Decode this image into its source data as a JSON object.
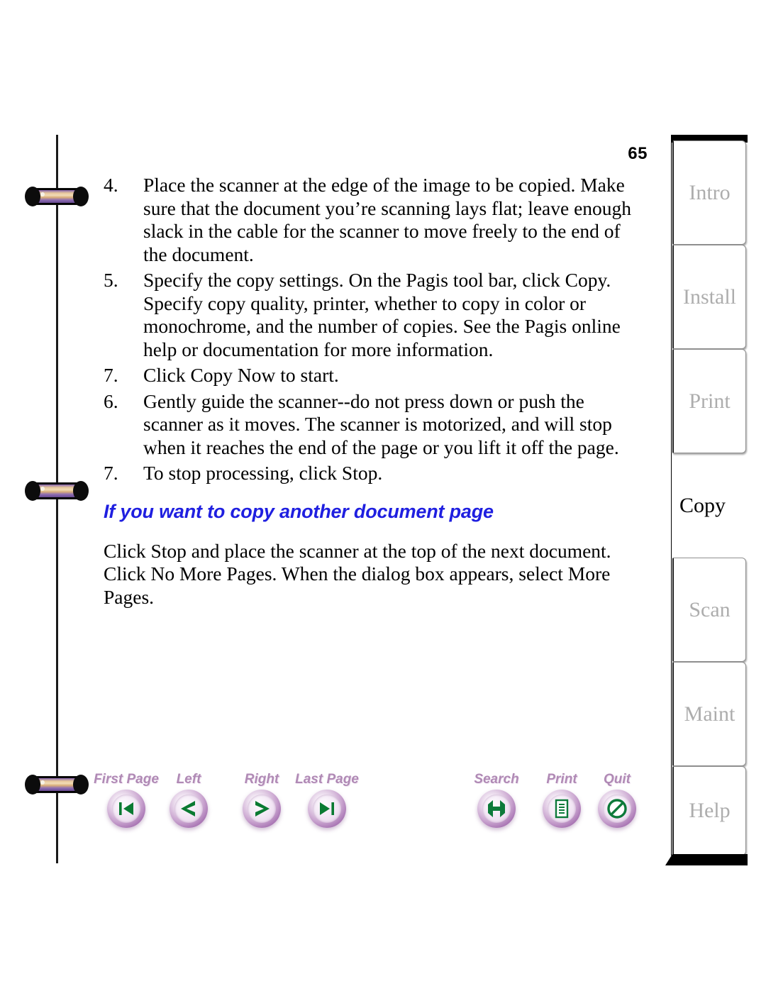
{
  "page": {
    "number": "65"
  },
  "content": {
    "steps": [
      {
        "num": "4.",
        "text": "Place the scanner at the edge of the image to be copied. Make sure that the document you’re scanning lays flat; leave enough slack in the cable for the scanner to move freely to the end of the document."
      },
      {
        "num": "5.",
        "text": "Specify the copy settings. On the Pagis tool bar, click Copy. Specify copy quality, printer, whether to copy in color or monochrome, and the number of copies. See the Pagis online help or documentation for more information."
      },
      {
        "num": "7.",
        "text": "Click Copy Now to start."
      },
      {
        "num": "6.",
        "text": "Gently guide the scanner--do not press down or push the scanner as it moves. The scanner is motorized, and will stop when it reaches the end of the page or you lift it off the page."
      },
      {
        "num": "7.",
        "text": "To stop processing, click Stop."
      }
    ],
    "heading": "If you want to copy another document page",
    "heading_color": "#1f1fe0",
    "paragraph": "Click Stop and place the scanner at the top of the next document. Click No More Pages. When the dialog box appears, select More Pages."
  },
  "navbar": {
    "left_group": [
      {
        "label": "First Page",
        "icon": "first-page-icon"
      },
      {
        "label": "Left",
        "icon": "left-arrow-icon"
      },
      {
        "label": "Right",
        "icon": "right-arrow-icon"
      },
      {
        "label": "Last Page",
        "icon": "last-page-icon"
      }
    ],
    "right_group": [
      {
        "label": "Search",
        "icon": "search-icon"
      },
      {
        "label": "Print",
        "icon": "print-icon"
      },
      {
        "label": "Quit",
        "icon": "quit-icon"
      }
    ],
    "label_color": "#b08ab5",
    "glyph_color": "#0a7a32"
  },
  "sidebar": {
    "tabs": [
      {
        "label": "Intro",
        "active": false
      },
      {
        "label": "Install",
        "active": false
      },
      {
        "label": "Print",
        "active": false
      },
      {
        "label": "Copy",
        "active": true
      },
      {
        "label": "Scan",
        "active": false
      },
      {
        "label": "Maint",
        "active": false
      },
      {
        "label": "Help",
        "active": false
      }
    ],
    "inactive_color": "#adadad",
    "active_color": "#000000"
  }
}
